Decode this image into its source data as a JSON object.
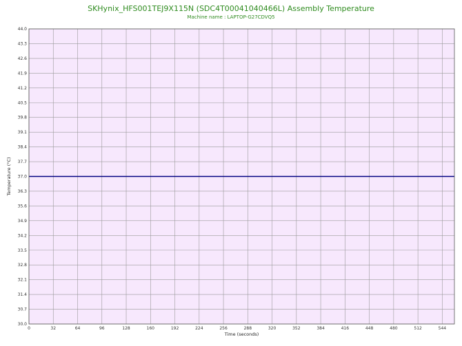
{
  "chart_data": {
    "type": "line",
    "title": "SKHynix_HFS001TEJ9X115N (SDC4T00041040466L) Assembly Temperature",
    "subtitle": "Machine name : LAPTOP-G27CDVQ5",
    "xlabel": "Time (seconds)",
    "ylabel": "Temperature (°C)",
    "xlim": [
      0,
      560
    ],
    "ylim": [
      30.0,
      44.0
    ],
    "x_ticks": [
      "0",
      "32",
      "64",
      "96",
      "128",
      "160",
      "192",
      "224",
      "256",
      "288",
      "320",
      "352",
      "384",
      "416",
      "448",
      "480",
      "512",
      "544"
    ],
    "y_ticks": [
      "44.0",
      "43.3",
      "42.6",
      "41.9",
      "41.2",
      "40.5",
      "39.8",
      "39.1",
      "38.4",
      "37.7",
      "37.0",
      "36.3",
      "35.6",
      "34.9",
      "34.2",
      "33.5",
      "32.8",
      "32.1",
      "31.4",
      "30.7",
      "30.0"
    ],
    "grid": true,
    "series": [
      {
        "x": [
          0,
          560
        ],
        "values": [
          37.0,
          37.0
        ]
      }
    ],
    "colors": {
      "plot_background": "#f7e8fd",
      "grid": "#9a9a9a",
      "series": "#000080",
      "title": "#2e8b1e"
    }
  }
}
